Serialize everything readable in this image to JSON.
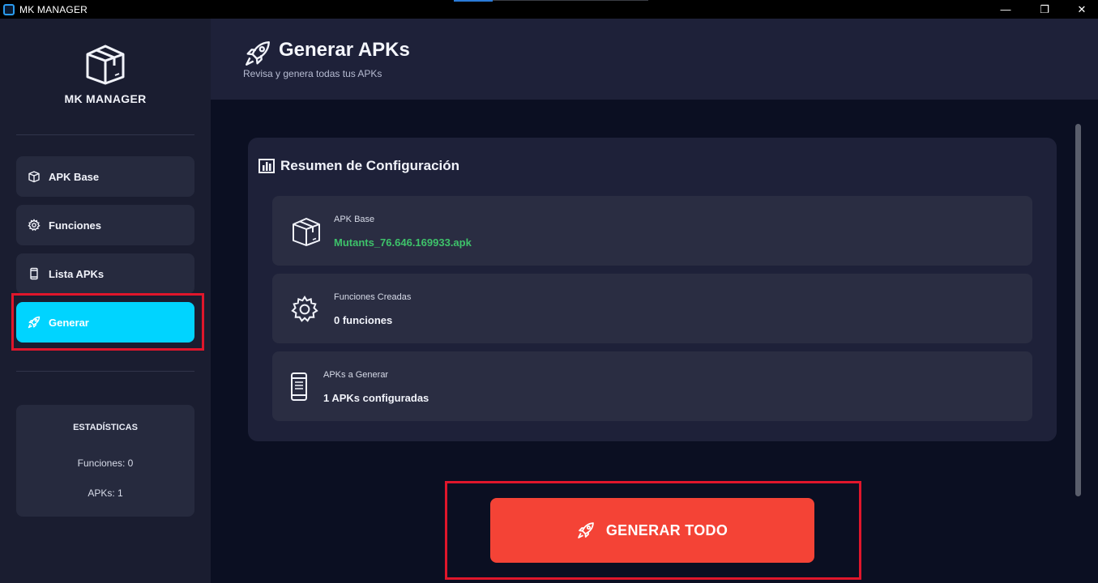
{
  "window": {
    "title": "MK MANAGER",
    "minimize_glyph": "—",
    "maximize_glyph": "❐",
    "close_glyph": "✕"
  },
  "sidebar": {
    "logo_title": "MK MANAGER",
    "items": [
      {
        "label": "APK Base",
        "icon": "package-icon"
      },
      {
        "label": "Funciones",
        "icon": "gear-icon"
      },
      {
        "label": "Lista APKs",
        "icon": "phone-icon"
      },
      {
        "label": "Generar",
        "icon": "rocket-icon",
        "active": true
      }
    ],
    "stats": {
      "title": "ESTADÍSTICAS",
      "funciones": "Funciones: 0",
      "apks": "APKs: 1"
    }
  },
  "header": {
    "icon": "rocket-icon",
    "title": "Generar APKs",
    "subtitle": "Revisa y genera todas tus APKs"
  },
  "summary": {
    "title": "Resumen de Configuración",
    "title_icon": "bar-chart-icon",
    "rows": [
      {
        "label": "APK Base",
        "value": "Mutants_76.646.169933.apk",
        "icon": "package-icon"
      },
      {
        "label": "Funciones Creadas",
        "value": "0 funciones",
        "icon": "gear-icon"
      },
      {
        "label": "APKs a Generar",
        "value": "1 APKs configuradas",
        "icon": "phone-icon"
      }
    ]
  },
  "generate_button": {
    "label": "GENERAR TODO",
    "icon": "rocket-icon"
  },
  "colors": {
    "accent": "#00d4ff",
    "danger": "#f44336",
    "success": "#3ec26a",
    "highlight_frame": "#e0162b"
  }
}
